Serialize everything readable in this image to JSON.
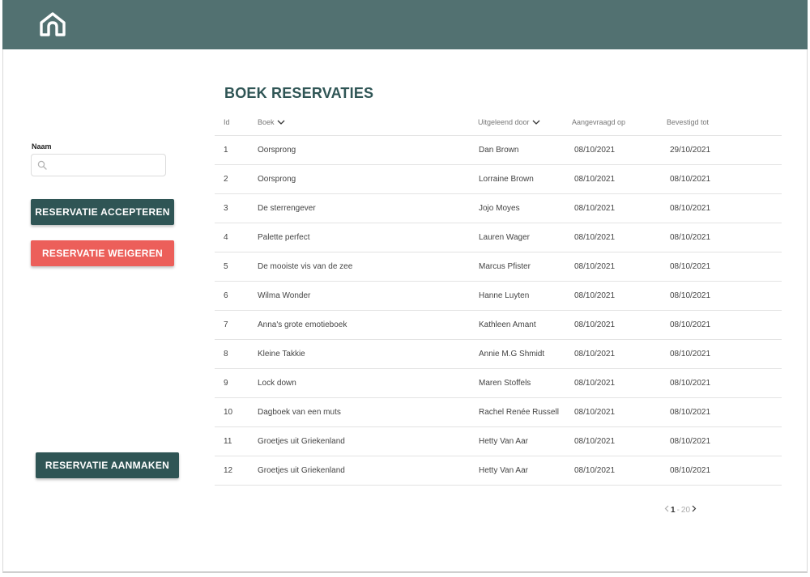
{
  "colors": {
    "topbar": "#527171",
    "primary": "#2f5555",
    "danger": "#ec5f5a"
  },
  "header": {
    "home_icon": "home-icon"
  },
  "sidebar": {
    "name_label": "Naam",
    "search_placeholder": "",
    "accept_label": "RESERVATIE ACCEPTEREN",
    "refuse_label": "RESERVATIE WEIGEREN",
    "create_label": "RESERVATIE AANMAKEN"
  },
  "main": {
    "title": "BOEK RESERVATIES",
    "columns": {
      "id": "Id",
      "boek": "Boek",
      "uitgeleend": "Uitgeleend door",
      "aangevraagd": "Aangevraagd op",
      "bevestigd": "Bevestigd tot"
    },
    "rows": [
      {
        "id": "1",
        "boek": "Oorsprong",
        "uitgeleend": "Dan Brown",
        "aangevraagd": "08/10/2021",
        "bevestigd": "29/10/2021"
      },
      {
        "id": "2",
        "boek": "Oorsprong",
        "uitgeleend": "Lorraine Brown",
        "aangevraagd": "08/10/2021",
        "bevestigd": "08/10/2021"
      },
      {
        "id": "3",
        "boek": "De sterrengever",
        "uitgeleend": "Jojo Moyes",
        "aangevraagd": "08/10/2021",
        "bevestigd": "08/10/2021"
      },
      {
        "id": "4",
        "boek": "Palette perfect",
        "uitgeleend": "Lauren Wager",
        "aangevraagd": "08/10/2021",
        "bevestigd": "08/10/2021"
      },
      {
        "id": "5",
        "boek": "De mooiste vis van de zee",
        "uitgeleend": "Marcus Pfister",
        "aangevraagd": "08/10/2021",
        "bevestigd": "08/10/2021"
      },
      {
        "id": "6",
        "boek": "Wilma Wonder",
        "uitgeleend": "Hanne Luyten",
        "aangevraagd": "08/10/2021",
        "bevestigd": "08/10/2021"
      },
      {
        "id": "7",
        "boek": "Anna's grote emotieboek",
        "uitgeleend": "Kathleen Amant",
        "aangevraagd": "08/10/2021",
        "bevestigd": "08/10/2021"
      },
      {
        "id": "8",
        "boek": "Kleine Takkie",
        "uitgeleend": "Annie M.G Shmidt",
        "aangevraagd": "08/10/2021",
        "bevestigd": "08/10/2021"
      },
      {
        "id": "9",
        "boek": "Lock down",
        "uitgeleend": "Maren Stoffels",
        "aangevraagd": "08/10/2021",
        "bevestigd": "08/10/2021"
      },
      {
        "id": "10",
        "boek": "Dagboek van een muts",
        "uitgeleend": "Rachel Renée Russell",
        "aangevraagd": "08/10/2021",
        "bevestigd": "08/10/2021"
      },
      {
        "id": "11",
        "boek": "Groetjes uit Griekenland",
        "uitgeleend": "Hetty Van Aar",
        "aangevraagd": "08/10/2021",
        "bevestigd": "08/10/2021"
      },
      {
        "id": "12",
        "boek": "Groetjes uit Griekenland",
        "uitgeleend": "Hetty Van Aar",
        "aangevraagd": "08/10/2021",
        "bevestigd": "08/10/2021"
      }
    ],
    "pager": {
      "current": "1",
      "separator": "-",
      "total": "20"
    }
  }
}
